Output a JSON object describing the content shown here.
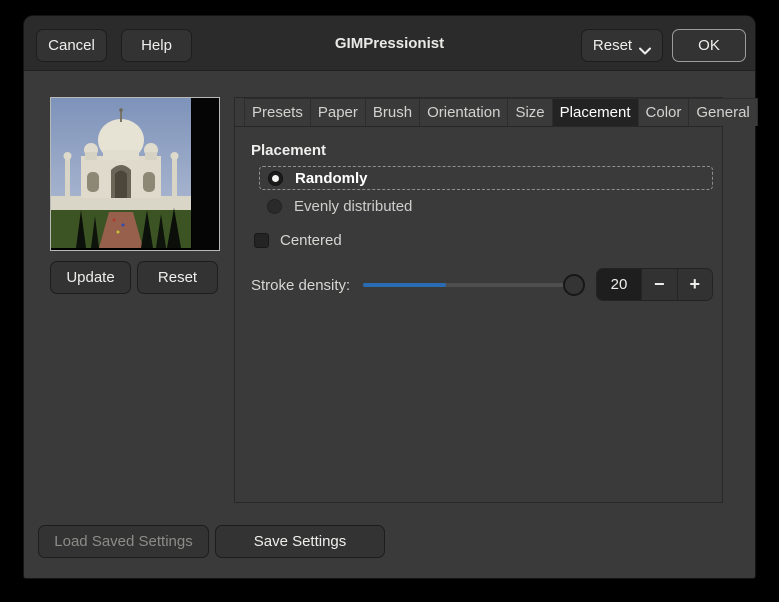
{
  "window": {
    "title": "GIMPressionist"
  },
  "header": {
    "cancel_label": "Cancel",
    "help_label": "Help",
    "reset_menu_label": "Reset",
    "ok_label": "OK"
  },
  "preview": {
    "image_alt": "taj-mahal-preview",
    "update_label": "Update",
    "reset_label": "Reset"
  },
  "tabs": [
    {
      "label": "Presets"
    },
    {
      "label": "Paper"
    },
    {
      "label": "Brush"
    },
    {
      "label": "Orientation"
    },
    {
      "label": "Size"
    },
    {
      "label": "Placement"
    },
    {
      "label": "Color"
    },
    {
      "label": "General"
    }
  ],
  "active_tab": "Placement",
  "placement": {
    "heading": "Placement",
    "radio_randomly": "Randomly",
    "radio_randomly_selected": true,
    "radio_evenly": "Evenly distributed",
    "radio_evenly_selected": false,
    "checkbox_centered": "Centered",
    "checkbox_centered_checked": false,
    "stroke_density_label": "Stroke density:",
    "stroke_density_value": "20",
    "minus_glyph": "−",
    "plus_glyph": "+"
  },
  "footer": {
    "load_label": "Load Saved Settings",
    "load_enabled": false,
    "save_label": "Save Settings"
  },
  "colors": {
    "accent_blue": "#2a6cb4",
    "dialog_bg": "#3a3a3a",
    "headerbar_bg": "#2b2b2b",
    "active_tab_bg": "#232323",
    "entry_bg": "#1e1e1e"
  }
}
